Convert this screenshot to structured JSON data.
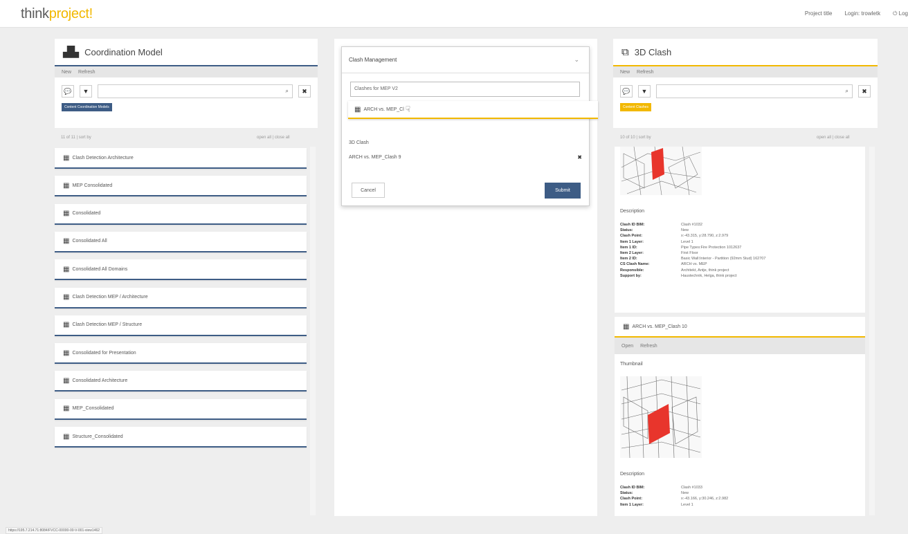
{
  "header": {
    "logo_think": "think",
    "logo_project": "project!",
    "nav": [
      "Project title",
      "Login: trowletk",
      "Log"
    ]
  },
  "coord": {
    "title": "Coordination Model",
    "icon": "buildings-icon",
    "toolbar": [
      "New",
      "Refresh"
    ],
    "tag": "Content Coordination Models",
    "count": "11 of 11 | sort by",
    "openclose": "open all | close all",
    "items": [
      "Clash Detection Architecture",
      "MEP Consolidated",
      "Consolidated",
      "Consolidated All",
      "Consolidated All Domains",
      "Clash Detection MEP / Architecture",
      "Clash Detection MEP / Structure",
      "Consolidated for Presentation",
      "Consolidated Architecture",
      "MEP_Consolidated",
      "Structure_Consolidated"
    ]
  },
  "modal": {
    "title": "Clash Management",
    "search_value": "Clashes for MEP V2",
    "suggestion": "ARCH vs. MEP_Cl",
    "section_label": "3D Clash",
    "selected": "ARCH vs. MEP_Clash 9",
    "cancel": "Cancel",
    "submit": "Submit"
  },
  "clash": {
    "title": "3D Clash",
    "icon": "cube-icon",
    "toolbar": [
      "New",
      "Refresh"
    ],
    "tag": "Content Clashes",
    "count": "10 of 10 | sort by",
    "openclose": "open all | close all",
    "desc_label": "Description",
    "details1": [
      [
        "Clash ID BIM:",
        "Clash #1032"
      ],
      [
        "Status:",
        "New"
      ],
      [
        "Clash Point:",
        "x:-43.315, y:28.790, z:2.979"
      ],
      [
        "Item 1 Layer:",
        "Level 1"
      ],
      [
        "Item 1 ID:",
        "Pipe Types:Fire Protection 1012637"
      ],
      [
        "Item 2 Layer:",
        "First Floor"
      ],
      [
        "Item 2 ID:",
        "Basic Wall:Interior - Partition (92mm Stud) 162707"
      ],
      [
        "CS Clash Name:",
        "ARCH vs. MEP"
      ],
      [
        "Responsible:",
        "Architekt, Antje, think project"
      ],
      [
        "Support by:",
        "Haustechnik, Helga, think project"
      ]
    ],
    "card2_title": "ARCH vs. MEP_Clash 10",
    "card2_toolbar": [
      "Open",
      "Refresh"
    ],
    "thumb_label": "Thumbnail",
    "details2": [
      [
        "Clash ID BIM:",
        "Clash #1033"
      ],
      [
        "Status:",
        "New"
      ],
      [
        "Clash Point:",
        "x:-43.166, y:30.246, z:2.982"
      ],
      [
        "Item 1 Layer:",
        "Level 1"
      ]
    ]
  },
  "status_url": "https://195.7.214.71:8084/FVCC-00000-00-V-001-view1462",
  "colors": {
    "accent_blue": "#3d5c85",
    "accent_yellow": "#f2b800",
    "clash_red": "#e8352c"
  }
}
